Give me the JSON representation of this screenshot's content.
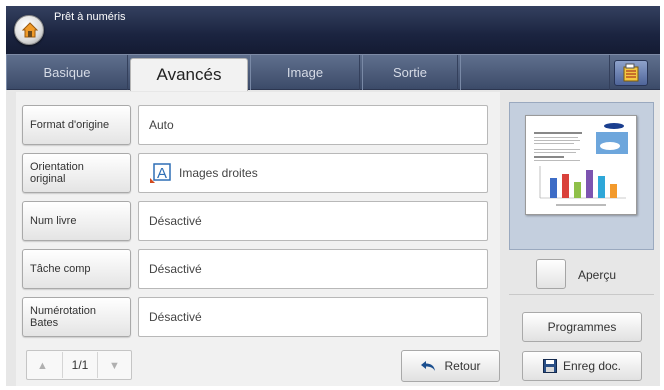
{
  "header": {
    "title": "Prêt à numéris"
  },
  "tabs": [
    {
      "label": "Basique",
      "active": false
    },
    {
      "label": "Avancés",
      "active": true
    },
    {
      "label": "Image",
      "active": false
    },
    {
      "label": "Sortie",
      "active": false
    }
  ],
  "settings": [
    {
      "label": "Format d'origine",
      "value": "Auto"
    },
    {
      "label": "Orientation original",
      "value": "Images droites",
      "icon": "orientation-upright-icon"
    },
    {
      "label": "Num livre",
      "value": "Désactivé"
    },
    {
      "label": "Tâche comp",
      "value": "Désactivé"
    },
    {
      "label": "Numérotation Bates",
      "value": "Désactivé"
    }
  ],
  "pager": {
    "page": "1/1"
  },
  "buttons": {
    "back": "Retour",
    "preview": "Aperçu",
    "programs": "Programmes",
    "save_doc": "Enreg doc."
  },
  "colors": {
    "titlebar": "#1b2440",
    "tabbar": "#4a5a79",
    "preview_panel": "#c4cfde",
    "orientation_icon": "#2f6fb5",
    "orientation_arrow": "#d24a1e"
  }
}
